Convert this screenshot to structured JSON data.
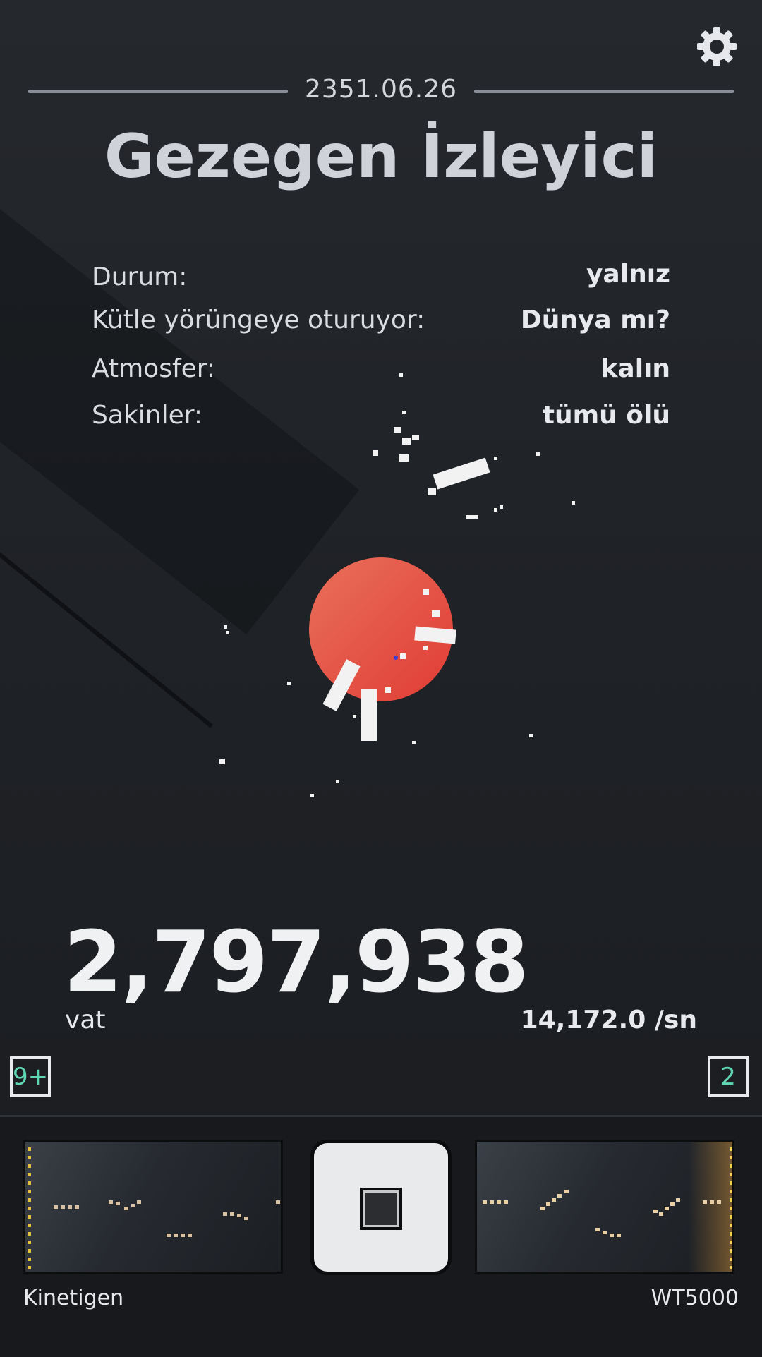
{
  "header": {
    "date": "2351.06.26",
    "title": "Gezegen İzleyici",
    "settings_icon": "gear-icon"
  },
  "stats": [
    {
      "label": "Durum:",
      "value": "yalnız"
    },
    {
      "label": "Kütle yörüngeye oturuyor:",
      "value": "Dünya mı?"
    },
    {
      "label": "Atmosfer:",
      "value": "kalın"
    },
    {
      "label": "Sakinler:",
      "value": "tümü ölü"
    }
  ],
  "score": {
    "value": "2,797,938",
    "unit": "vat",
    "rate": "14,172.0 /sn"
  },
  "badges": {
    "left": "9+",
    "right": "2"
  },
  "dock": {
    "left_label": "Kinetigen",
    "right_label": "WT5000",
    "stop_icon": "stop-icon"
  },
  "colors": {
    "planet": "#e4523f",
    "badge_text": "#5fd7b1",
    "accent_left": "#e8c33e",
    "accent_right": "#f0a640"
  }
}
